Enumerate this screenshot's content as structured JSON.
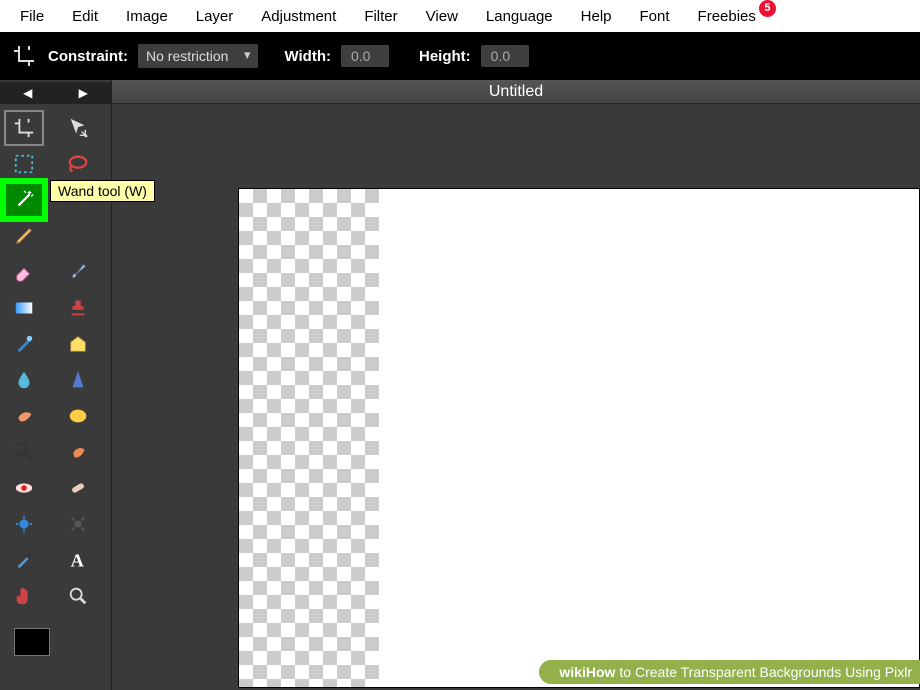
{
  "menu": {
    "items": [
      "File",
      "Edit",
      "Image",
      "Layer",
      "Adjustment",
      "Filter",
      "View",
      "Language",
      "Help",
      "Font",
      "Freebies"
    ],
    "freebies_badge": "5"
  },
  "options": {
    "constraint_label": "Constraint:",
    "constraint_value": "No restriction",
    "width_label": "Width:",
    "width_value": "0.0",
    "height_label": "Height:",
    "height_value": "0.0"
  },
  "document": {
    "title": "Untitled"
  },
  "tooltip": {
    "wand": "Wand tool (W)"
  },
  "banner": {
    "wiki": "wiki",
    "how": "How",
    "rest": " to Create Transparent Backgrounds Using Pixlr"
  },
  "tools": {
    "row0": [
      "crop-icon",
      "move-icon"
    ],
    "row1": [
      "marquee-icon",
      "lasso-icon"
    ],
    "row2": [
      "wand-icon",
      ""
    ],
    "row3": [
      "pencil-icon",
      ""
    ],
    "row4": [
      "eraser-icon",
      "brush-icon"
    ],
    "row5": [
      "gradient-icon",
      "stamp-icon"
    ],
    "row6": [
      "colorreplace-icon",
      "drawshape-icon"
    ],
    "row7": [
      "blur-icon",
      "sharpen-icon"
    ],
    "row8": [
      "smudge-icon",
      "sponge-icon"
    ],
    "row9": [
      "dodge-icon",
      "burn-icon"
    ],
    "row10": [
      "redeye-icon",
      "spot-icon"
    ],
    "row11": [
      "bloat-icon",
      "pinch-icon"
    ],
    "row12": [
      "colorpicker-icon",
      "type-icon"
    ],
    "row13": [
      "hand-icon",
      "zoom-icon"
    ]
  }
}
